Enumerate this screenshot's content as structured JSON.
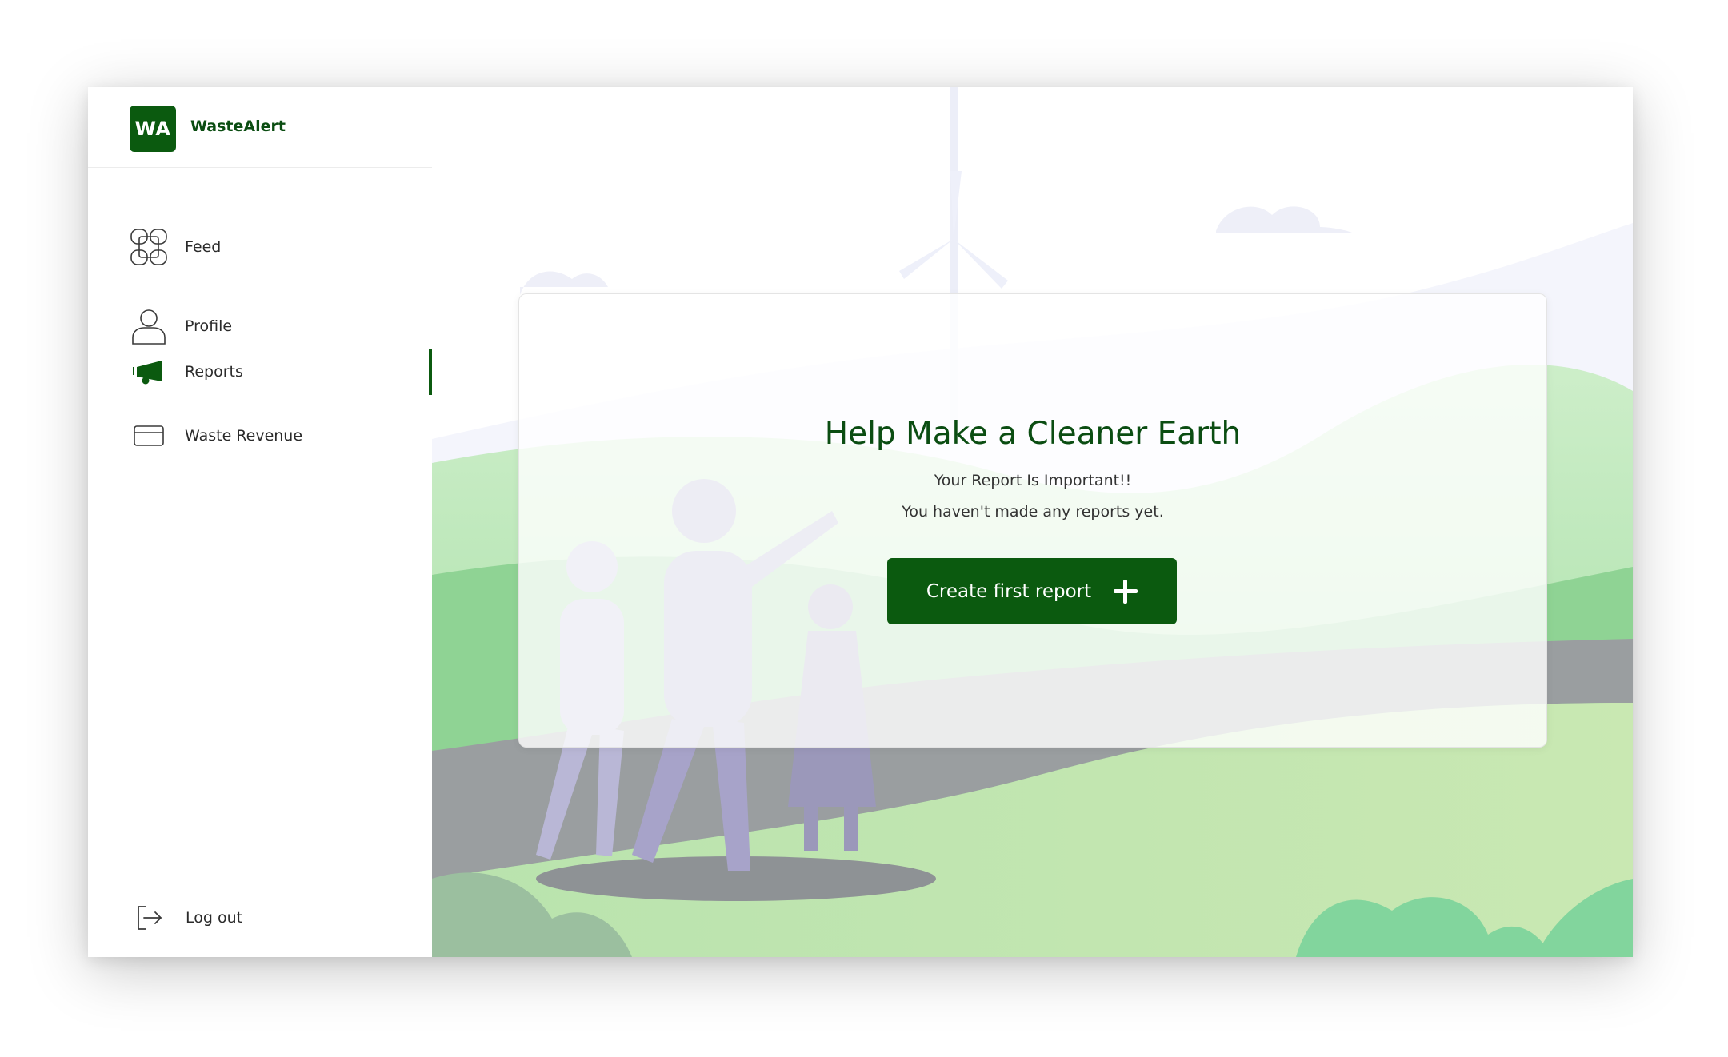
{
  "brand": {
    "logo_text": "WA",
    "name": "WasteAlert"
  },
  "sidebar": {
    "items": [
      {
        "label": "Feed",
        "icon": "feed-grid-icon"
      },
      {
        "label": "Profile",
        "icon": "user-icon"
      },
      {
        "label": "Reports",
        "icon": "megaphone-icon",
        "active": true
      },
      {
        "label": "Waste Revenue",
        "icon": "credit-card-icon"
      }
    ],
    "logout": {
      "label": "Log out",
      "icon": "logout-icon"
    }
  },
  "main": {
    "title": "Help Make a Cleaner Earth",
    "subtitle": "Your Report Is Important!!",
    "empty_message": "You haven't made any reports yet.",
    "cta_label": "Create first report",
    "cta_icon": "plus-icon"
  },
  "colors": {
    "brand_green": "#0b5a0f",
    "title_green": "#0b4d12",
    "hill_green": "#9fdc9f",
    "road_gray": "#9a9ea0"
  }
}
